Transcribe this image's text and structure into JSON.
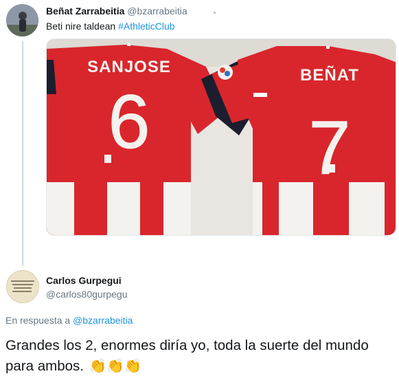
{
  "tweet": {
    "author_name": "Beñat Zarrabeitia",
    "author_handle": "@bzarrabeitia",
    "text_prefix": "Beti nire taldean ",
    "hashtag": "#AthleticClub",
    "image": {
      "left_shirt": {
        "name": "SANJOSE",
        "number": "6"
      },
      "right_shirt": {
        "name": "BEÑAT",
        "number": "7"
      },
      "colors": {
        "red": "#d9262c",
        "white": "#f4f2ee",
        "navy": "#1c1d2e"
      }
    }
  },
  "reply": {
    "author_name": "Carlos Gurpegui",
    "author_handle": "@carlos80gurpegu",
    "reply_label": "En respuesta a ",
    "reply_to_handle": "@bzarrabeitia",
    "text": "Grandes los 2, enormes diría yo, toda la suerte del mundo para ambos.",
    "emoji": "👏👏👏"
  },
  "colors": {
    "link": "#1b95e0",
    "secondary_text": "#657786",
    "thread_line": "#ccd6dd"
  }
}
